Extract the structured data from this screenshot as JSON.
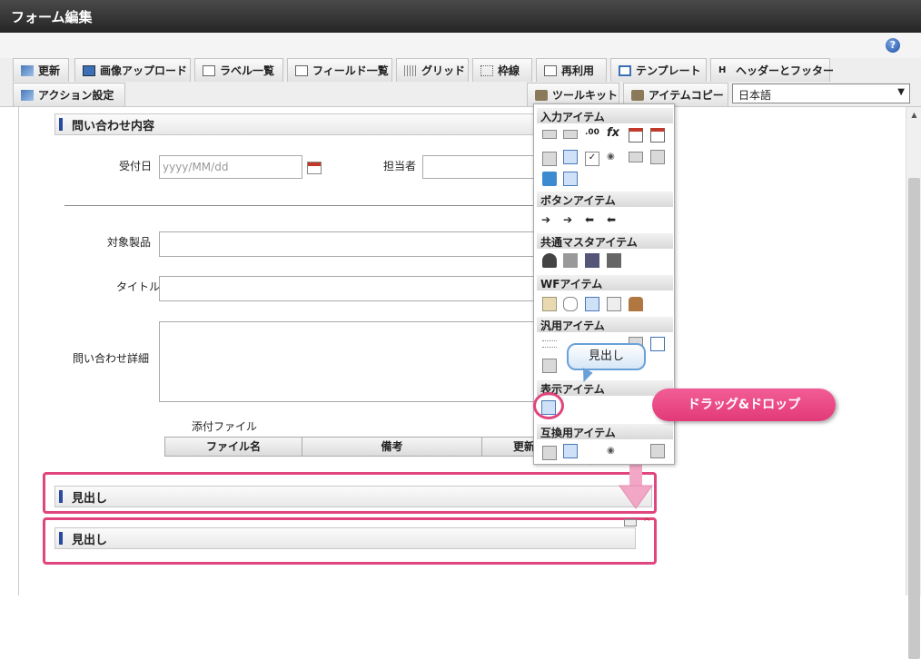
{
  "window": {
    "title": "フォーム編集"
  },
  "toolbar": {
    "row1": [
      {
        "label": "更新",
        "icon": "update-icon"
      },
      {
        "label": "画像アップロード",
        "icon": "image-upload-icon"
      },
      {
        "label": "ラベル一覧",
        "icon": "label-list-icon"
      },
      {
        "label": "フィールド一覧",
        "icon": "field-list-icon"
      },
      {
        "label": "グリッド",
        "icon": "grid-icon"
      },
      {
        "label": "枠線",
        "icon": "border-icon"
      },
      {
        "label": "再利用",
        "icon": "reuse-icon"
      },
      {
        "label": "テンプレート",
        "icon": "template-icon"
      },
      {
        "label": "ヘッダーとフッター",
        "icon": "header-footer-icon"
      }
    ],
    "row2": [
      {
        "label": "アクション設定",
        "icon": "action-settings-icon"
      },
      {
        "label": "ツールキット",
        "icon": "toolkit-icon"
      },
      {
        "label": "アイテムコピー",
        "icon": "item-copy-icon"
      }
    ],
    "language": "日本語"
  },
  "form": {
    "section_heading": "問い合わせ内容",
    "received_date_label": "受付日",
    "received_date_placeholder": "yyyy/MM/dd",
    "assignee_label": "担当者",
    "product_label": "対象製品",
    "title_label": "タイトル",
    "detail_label": "問い合わせ詳細",
    "attachment_label": "添付ファイル",
    "attachment_columns": [
      "ファイル名",
      "備考",
      "更新"
    ],
    "heading_item_1": "見出し",
    "heading_item_2": "見出し"
  },
  "palette": {
    "sections": [
      "入力アイテム",
      "ボタンアイテム",
      "共通マスタアイテム",
      "WFアイテム",
      "汎用アイテム",
      "表示アイテム",
      "互換用アイテム"
    ],
    "decimal_icon_text": ".00",
    "fx_icon_text": "fx"
  },
  "annotations": {
    "callout": "見出し",
    "drag_drop": "ドラッグ&ドロップ",
    "highlight_color": "#e0457e",
    "callout_color": "#6aa0d8"
  }
}
